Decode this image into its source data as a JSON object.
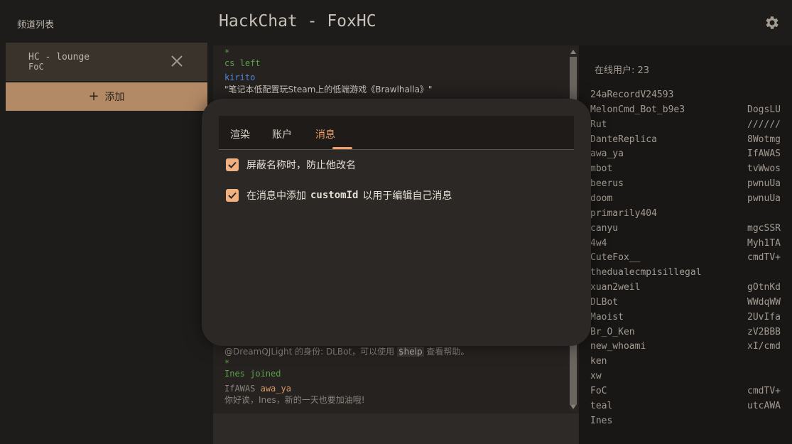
{
  "sidebar": {
    "title": "频道列表",
    "channel": {
      "name": "HC - lounge",
      "owner": "FoC"
    },
    "add_label": "添加"
  },
  "header": {
    "title": "HackChat - FoxHC"
  },
  "chat": {
    "lines": [
      {
        "text": "*",
        "style": "green"
      },
      {
        "text": "cs left",
        "style": "green"
      },
      {
        "text": "kirito",
        "style": "blue"
      },
      {
        "text": "\"笔记本低配置玩Steam上的低端游戏《Brawlhalla》\"",
        "style": "text"
      }
    ],
    "bottom": {
      "dlbot_prefix": "@DreamQJLight 的身份: DLBot，可以使用",
      "dlbot_code": "$help",
      "dlbot_suffix": "查看帮助。",
      "star": "*",
      "joined": "Ines joined",
      "trip": "IfAWAS",
      "nick": "awa_ya",
      "message": "你好诶，Ines，新的一天也要加油哦!"
    }
  },
  "users": {
    "online_label": "在线用户: 23",
    "list": [
      {
        "name": "24aRecordV24593",
        "trip": ""
      },
      {
        "name": "MelonCmd_Bot_b9e3",
        "trip": "DogsLU"
      },
      {
        "name": "Rut",
        "trip": "//////"
      },
      {
        "name": "DanteReplica",
        "trip": "8Wotmg"
      },
      {
        "name": "awa_ya",
        "trip": "IfAWAS"
      },
      {
        "name": "mbot",
        "trip": "tvWwos"
      },
      {
        "name": "beerus",
        "trip": "pwnuUa"
      },
      {
        "name": "doom",
        "trip": "pwnuUa"
      },
      {
        "name": "primarily404",
        "trip": ""
      },
      {
        "name": "canyu",
        "trip": "mgcSSR"
      },
      {
        "name": "4w4",
        "trip": "Myh1TA"
      },
      {
        "name": "CuteFox__",
        "trip": "cmdTV+"
      },
      {
        "name": "thedualecmpisillegal",
        "trip": ""
      },
      {
        "name": "xuan2weil",
        "trip": "gOtnKd"
      },
      {
        "name": "DLBot",
        "trip": "WWdqWW"
      },
      {
        "name": "Maoist",
        "trip": "2UvIfa"
      },
      {
        "name": "Br_O_Ken",
        "trip": "zV2BBB"
      },
      {
        "name": "new_whoami",
        "trip": "xI/cmd"
      },
      {
        "name": "ken",
        "trip": ""
      },
      {
        "name": "xw",
        "trip": ""
      },
      {
        "name": "FoC",
        "trip": "cmdTV+"
      },
      {
        "name": "teal",
        "trip": "utcAWA"
      },
      {
        "name": "Ines",
        "trip": ""
      }
    ]
  },
  "modal": {
    "tabs": [
      "渲染",
      "账户",
      "消息"
    ],
    "active_tab": "消息",
    "options": [
      {
        "before": "屏蔽名称时，防止他改名",
        "code": "",
        "after": "",
        "checked": true
      },
      {
        "before": "在消息中添加",
        "code": "customId",
        "after": "以用于编辑自己消息",
        "checked": true
      }
    ]
  },
  "colors": {
    "accent": "#f0a068",
    "add_button": "#b38a66",
    "checkbox": "#f0b080"
  },
  "icons": {
    "close": "close-icon",
    "settings": "gear-icon",
    "add": "plus-icon",
    "check": "check-icon"
  }
}
